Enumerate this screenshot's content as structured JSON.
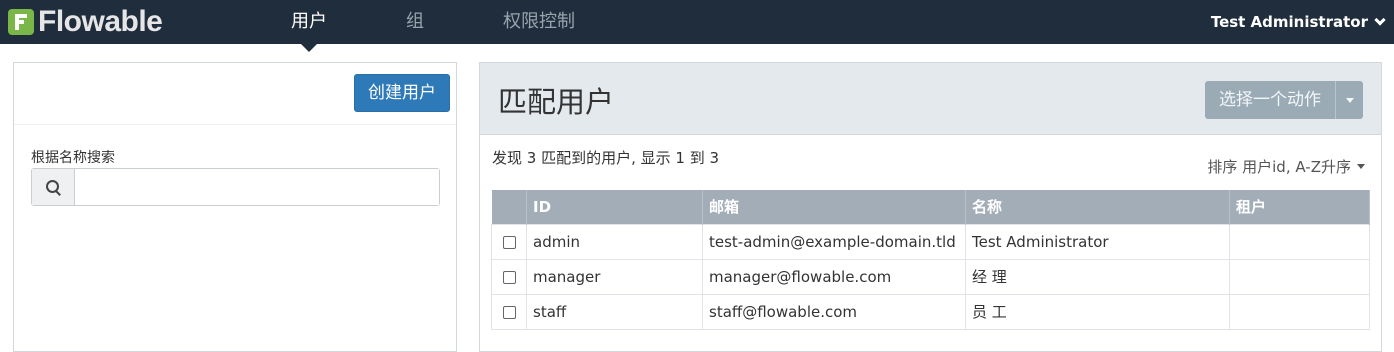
{
  "app": {
    "brand": "Flowable"
  },
  "nav": {
    "items": [
      {
        "label": "用户",
        "active": true
      },
      {
        "label": "组",
        "active": false
      },
      {
        "label": "权限控制",
        "active": false
      }
    ],
    "user_menu": "Test Administrator"
  },
  "left": {
    "create_label": "创建用户",
    "search_label": "根据名称搜索",
    "search_value": "",
    "search_placeholder": ""
  },
  "right": {
    "title": "匹配用户",
    "action_label": "选择一个动作",
    "result_summary": "发现 3 匹配到的用户, 显示 1 到 3",
    "sort_label": "排序 用户id, A-Z升序"
  },
  "table": {
    "headers": [
      "ID",
      "邮箱",
      "名称",
      "租户"
    ],
    "rows": [
      {
        "id": "admin",
        "email": "test-admin@example-domain.tld",
        "name": "Test Administrator",
        "tenant": ""
      },
      {
        "id": "manager",
        "email": "manager@flowable.com",
        "name": "经 理",
        "tenant": ""
      },
      {
        "id": "staff",
        "email": "staff@flowable.com",
        "name": "员 工",
        "tenant": ""
      }
    ]
  },
  "colors": {
    "topbar": "#1f2d3d",
    "accent": "#2e7ab8",
    "brand_green": "#7ab648",
    "table_header": "#a3adb8"
  }
}
